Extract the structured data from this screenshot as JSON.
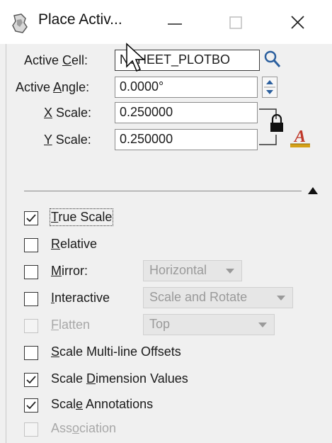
{
  "window": {
    "title": "Place Activ...",
    "minimize_label": "—",
    "maximize_label": "☐",
    "close_label": "✕"
  },
  "fields": {
    "active_cell": {
      "label_pre": "Active ",
      "label_key": "C",
      "label_post": "ell:",
      "value": "NSHEET_PLOTBO"
    },
    "active_angle": {
      "label_pre": "Active ",
      "label_key": "A",
      "label_post": "ngle:",
      "value": "0.0000°"
    },
    "x_scale": {
      "label_key": "X",
      "label_post": " Scale:",
      "value": "0.250000"
    },
    "y_scale": {
      "label_key": "Y",
      "label_post": " Scale:",
      "value": "0.250000"
    }
  },
  "options": {
    "true_scale": {
      "label_key": "T",
      "label_post": "rue Scale",
      "checked": true,
      "enabled": true
    },
    "relative": {
      "label_key": "R",
      "label_post": "elative",
      "checked": false,
      "enabled": true
    },
    "mirror": {
      "label_key": "M",
      "label_post": "irror:",
      "checked": false,
      "enabled": true,
      "dropdown": "Horizontal"
    },
    "interactive": {
      "label_key": "I",
      "label_post": "nteractive",
      "checked": false,
      "enabled": true,
      "dropdown": "Scale and Rotate"
    },
    "flatten": {
      "label_key": "F",
      "label_post": "latten",
      "checked": false,
      "enabled": false,
      "dropdown": "Top"
    },
    "scale_multiline": {
      "label_key": "S",
      "label_post": "cale Multi-line Offsets",
      "checked": false,
      "enabled": true
    },
    "scale_dimension": {
      "label_pre": "Scale ",
      "label_key": "D",
      "label_post": "imension Values",
      "checked": true,
      "enabled": true
    },
    "scale_annotations": {
      "label_pre": "Scal",
      "label_key": "e",
      "label_post": " Annotations",
      "checked": true,
      "enabled": true
    },
    "association": {
      "label_pre": "Ass",
      "label_key": "o",
      "label_post": "ciation",
      "checked": false,
      "enabled": false
    }
  },
  "colors": {
    "panel_bg": "#f0f0f0",
    "accent_red": "#c0392b",
    "gold": "#d4a017",
    "disabled_text": "#a8a8a8"
  },
  "icons": [
    "app-icon",
    "search-icon",
    "spinner-icon",
    "lock-icon",
    "text-style-icon",
    "collapse-triangle-icon",
    "cursor-icon"
  ]
}
